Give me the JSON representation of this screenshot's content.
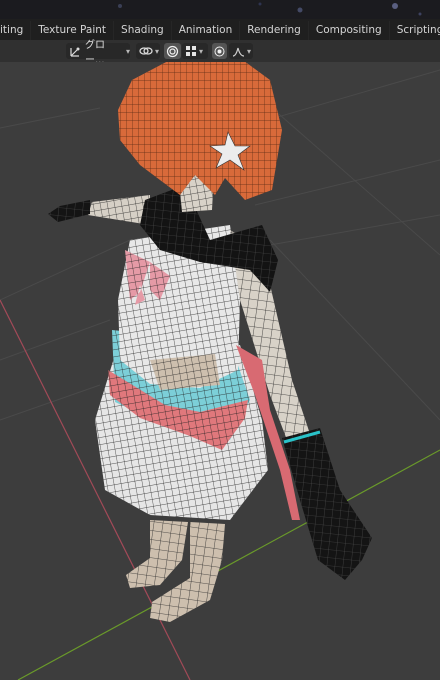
{
  "workspace_tabs": [
    {
      "label": "iting"
    },
    {
      "label": "Texture Paint"
    },
    {
      "label": "Shading"
    },
    {
      "label": "Animation"
    },
    {
      "label": "Rendering"
    },
    {
      "label": "Compositing"
    },
    {
      "label": "Scripting"
    }
  ],
  "add_tab_label": "+",
  "viewport_header": {
    "transform_orientation": "グロー...",
    "icons": [
      "transform-pivot-icon",
      "snap-link-icon",
      "proportional-editing-icon",
      "snap-increment-icon",
      "overlay-dot-icon",
      "curve-falloff-icon"
    ]
  },
  "colors": {
    "tabbar": "#1d1d1d",
    "header": "#303030",
    "viewport_bg": "#3d3d3d",
    "grid_line": "#4a4a4a",
    "x_axis": "#a24a58",
    "y_axis": "#6a9a2a",
    "hair": "#d86a3a",
    "skin": "#d6cfc4",
    "skirt_cyan": "#7ccfd8",
    "skirt_pink": "#e0787c",
    "glove_black": "#1a1a1a",
    "bow_pink": "#e59aa6"
  }
}
